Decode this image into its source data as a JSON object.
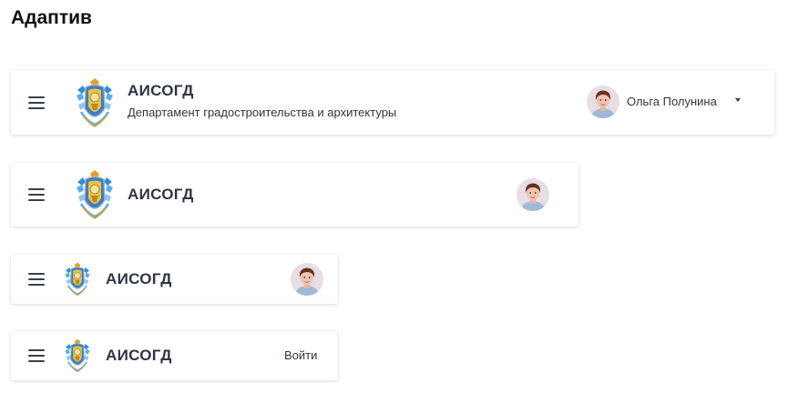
{
  "page": {
    "title": "Адаптив"
  },
  "app": {
    "name": "АИСОГД",
    "subtitle": "Департамент градостроительства и архитектуры"
  },
  "user": {
    "name": "Ольга Полунина"
  },
  "auth": {
    "login_label": "Войти"
  },
  "icons": {
    "menu": "hamburger-menu-icon",
    "emblem": "coat-of-arms-emblem",
    "avatar": "user-avatar-photo",
    "dropdown": "caret-down-icon"
  },
  "colors": {
    "text": "#2f3542",
    "emblem_blue": "#2f8fd8",
    "emblem_gold": "#d8a431"
  }
}
